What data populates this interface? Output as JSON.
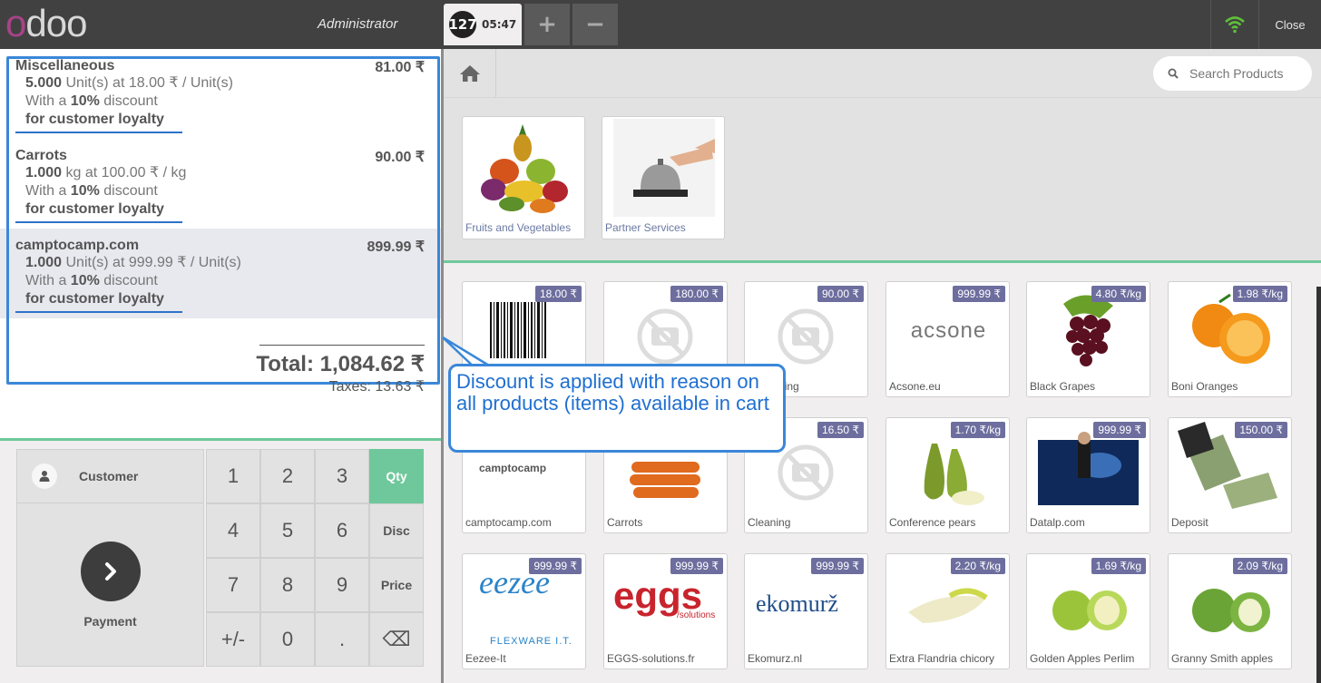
{
  "topbar": {
    "logo": "odoo",
    "user": "Administrator",
    "order_number": "127",
    "order_time": "05:47",
    "add_label": "+",
    "remove_label": "−",
    "close_label": "Close"
  },
  "orderlines": [
    {
      "name": "Miscellaneous",
      "price": "81.00 ₹",
      "qty": "5.000",
      "unit_text": "Unit(s) at 18.00 ₹ / Unit(s)",
      "disc_prefix": "With a",
      "disc": "10%",
      "disc_suffix": "discount",
      "reason": "for customer loyalty"
    },
    {
      "name": "Carrots",
      "price": "90.00 ₹",
      "qty": "1.000",
      "unit_text": "kg at 100.00 ₹ / kg",
      "disc_prefix": "With a",
      "disc": "10%",
      "disc_suffix": "discount",
      "reason": "for customer loyalty"
    },
    {
      "name": "camptocamp.com",
      "price": "899.99 ₹",
      "qty": "1.000",
      "unit_text": "Unit(s) at 999.99 ₹ / Unit(s)",
      "disc_prefix": "With a",
      "disc": "10%",
      "disc_suffix": "discount",
      "reason": "for customer loyalty"
    }
  ],
  "totals": {
    "total": "Total: 1,084.62 ₹",
    "taxes": "Taxes: 13.63 ₹"
  },
  "pad": {
    "customer_label": "Customer",
    "payment_label": "Payment",
    "keys": [
      "1",
      "2",
      "3",
      "Qty",
      "4",
      "5",
      "6",
      "Disc",
      "7",
      "8",
      "9",
      "Price",
      "+/-",
      "0",
      ".",
      "⌫"
    ]
  },
  "search": {
    "placeholder": "Search Products"
  },
  "categories": [
    {
      "label": "Fruits and Vegetables"
    },
    {
      "label": "Partner Services"
    }
  ],
  "products": [
    {
      "label": "",
      "price": "18.00 ₹"
    },
    {
      "label": "",
      "price": "180.00 ₹"
    },
    {
      "label": "Consulting",
      "price": "90.00 ₹"
    },
    {
      "label": "Acsone.eu",
      "price": "999.99 ₹",
      "logo": "acsone"
    },
    {
      "label": "Black Grapes",
      "price": "4.80 ₹/kg"
    },
    {
      "label": "Boni Oranges",
      "price": "1.98 ₹/kg"
    },
    {
      "label": "camptocamp.com",
      "price": "",
      "logo": "camptocamp"
    },
    {
      "label": "Carrots",
      "price": ""
    },
    {
      "label": "Cleaning",
      "price": "16.50 ₹"
    },
    {
      "label": "Conference pears",
      "price": "1.70 ₹/kg"
    },
    {
      "label": "Datalp.com",
      "price": "999.99 ₹"
    },
    {
      "label": "Deposit",
      "price": "150.00 ₹"
    },
    {
      "label": "Eezee-It",
      "price": "999.99 ₹",
      "logo": "eezee",
      "logo_sub": "FLEXWARE I.T."
    },
    {
      "label": "EGGS-solutions.fr",
      "price": "999.99 ₹",
      "logo": "eggs",
      "logo_sub": "/solutions"
    },
    {
      "label": "Ekomurz.nl",
      "price": "999.99 ₹",
      "logo": "ekomurž"
    },
    {
      "label": "Extra Flandria chicory",
      "price": "2.20 ₹/kg"
    },
    {
      "label": "Golden Apples Perlim",
      "price": "1.69 ₹/kg"
    },
    {
      "label": "Granny Smith apples",
      "price": "2.09 ₹/kg"
    }
  ],
  "callout": {
    "text": "Discount is applied with reason on all products (items) available in cart"
  },
  "colors": {
    "accent_green": "#6ec89b",
    "price_tag": "#6d6e9e",
    "highlight_blue": "#3a87d9",
    "topbar": "#414141"
  }
}
